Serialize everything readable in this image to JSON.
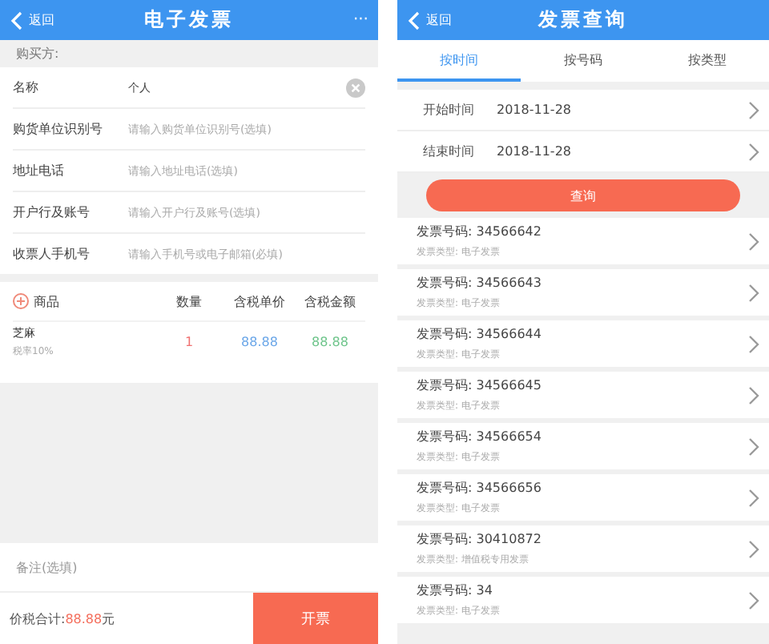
{
  "invoice_screen": {
    "back": "返回",
    "title": "电子发票",
    "more": "···",
    "section": "购买方:",
    "fields": [
      {
        "label": "名称",
        "value": "个人",
        "clearable": true
      },
      {
        "label": "购货单位识别号",
        "placeholder": "请输入购货单位识别号(选填)"
      },
      {
        "label": "地址电话",
        "placeholder": "请输入地址电话(选填)"
      },
      {
        "label": "开户行及账号",
        "placeholder": "请输入开户行及账号(选填)"
      },
      {
        "label": "收票人手机号",
        "placeholder": "请输入手机号或电子邮箱(必填)"
      }
    ],
    "table": {
      "columns": [
        "商品",
        "数量",
        "含税单价",
        "含税金额"
      ],
      "rows": [
        {
          "name": "芝麻",
          "tax_rate": "税率10%",
          "quantity": "1",
          "unit_price": "88.88",
          "amount": "88.88"
        }
      ]
    },
    "note": {
      "placeholder": "备注(选填)"
    },
    "total_label": "价税合计:",
    "total_value": "88.88",
    "total_unit": "元",
    "submit": "开票"
  },
  "query_screen": {
    "back": "返回",
    "title": "发票查询",
    "tabs": [
      {
        "label": "按时间",
        "selected": true
      },
      {
        "label": "按号码",
        "selected": false
      },
      {
        "label": "按类型",
        "selected": false
      }
    ],
    "dates": [
      {
        "label": "开始时间",
        "value": "2018-11-28"
      },
      {
        "label": "结束时间",
        "value": "2018-11-28"
      }
    ],
    "search": "查询",
    "results": [
      {
        "number": "发票号码: 34566642",
        "type": "发票类型: 电子发票"
      },
      {
        "number": "发票号码: 34566643",
        "type": "发票类型: 电子发票"
      },
      {
        "number": "发票号码: 34566644",
        "type": "发票类型: 电子发票"
      },
      {
        "number": "发票号码: 34566645",
        "type": "发票类型: 电子发票"
      },
      {
        "number": "发票号码: 34566654",
        "type": "发票类型: 电子发票"
      },
      {
        "number": "发票号码: 34566656",
        "type": "发票类型: 电子发票"
      },
      {
        "number": "发票号码: 30410872",
        "type": "发票类型: 增值税专用发票"
      },
      {
        "number": "发票号码: 34",
        "type": "发票类型: 电子发票"
      }
    ]
  }
}
